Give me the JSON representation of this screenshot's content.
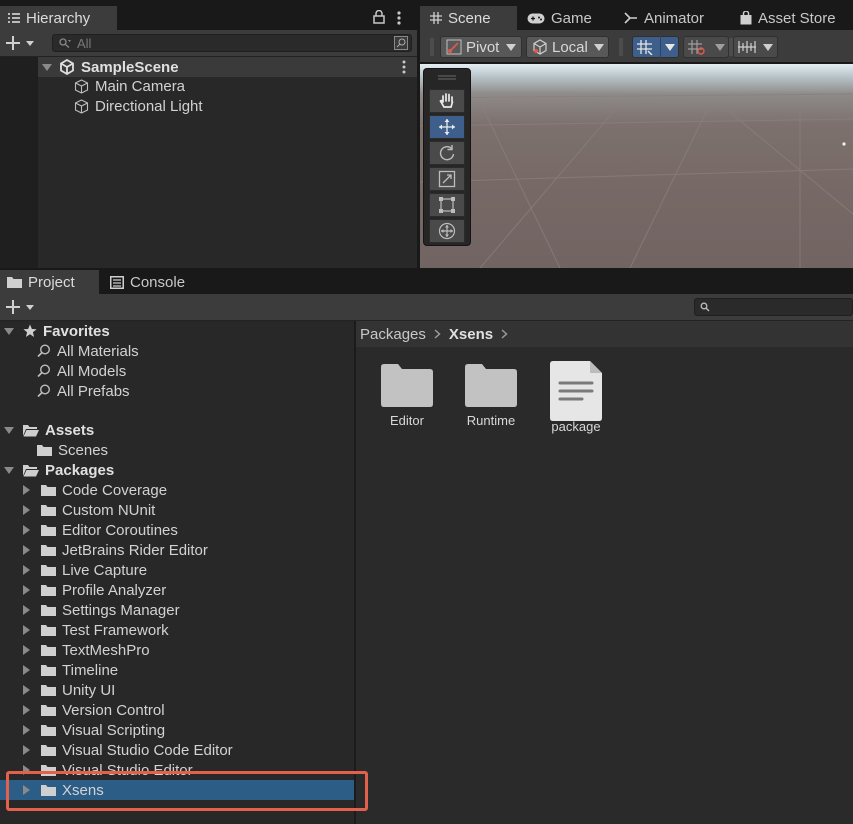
{
  "hierarchy": {
    "tab_label": "Hierarchy",
    "search_placeholder": "All",
    "scene_name": "SampleScene",
    "objects": [
      "Main Camera",
      "Directional Light"
    ]
  },
  "scene_panel": {
    "tabs": [
      {
        "label": "Scene",
        "icon": "grid-icon"
      },
      {
        "label": "Game",
        "icon": "gamepad-icon"
      },
      {
        "label": "Animator",
        "icon": "animator-icon"
      },
      {
        "label": "Asset Store",
        "icon": "bag-icon"
      }
    ],
    "pivot_label": "Pivot",
    "local_label": "Local",
    "tools": [
      "hand-tool",
      "move-tool",
      "rotate-tool",
      "scale-tool",
      "rect-tool",
      "transform-tool"
    ],
    "active_tool": "move-tool"
  },
  "project": {
    "tabs": [
      {
        "label": "Project",
        "icon": "folder-icon"
      },
      {
        "label": "Console",
        "icon": "console-icon"
      }
    ],
    "favorites": {
      "label": "Favorites",
      "items": [
        "All Materials",
        "All Models",
        "All Prefabs"
      ]
    },
    "assets": {
      "label": "Assets",
      "items": [
        "Scenes"
      ]
    },
    "packages": {
      "label": "Packages",
      "items": [
        "Code Coverage",
        "Custom NUnit",
        "Editor Coroutines",
        "JetBrains Rider Editor",
        "Live Capture",
        "Profile Analyzer",
        "Settings Manager",
        "Test Framework",
        "TextMeshPro",
        "Timeline",
        "Unity UI",
        "Version Control",
        "Visual Scripting",
        "Visual Studio Code Editor",
        "Visual Studio Editor",
        "Xsens"
      ],
      "selected": "Xsens"
    },
    "breadcrumb": [
      "Packages",
      "Xsens"
    ],
    "contents": [
      {
        "label": "Editor",
        "type": "folder"
      },
      {
        "label": "Runtime",
        "type": "folder"
      },
      {
        "label": "package",
        "type": "file"
      }
    ]
  },
  "colors": {
    "selection": "#2c5d87",
    "highlight_box": "#e2604c",
    "active_tool": "#3e5f8c"
  }
}
